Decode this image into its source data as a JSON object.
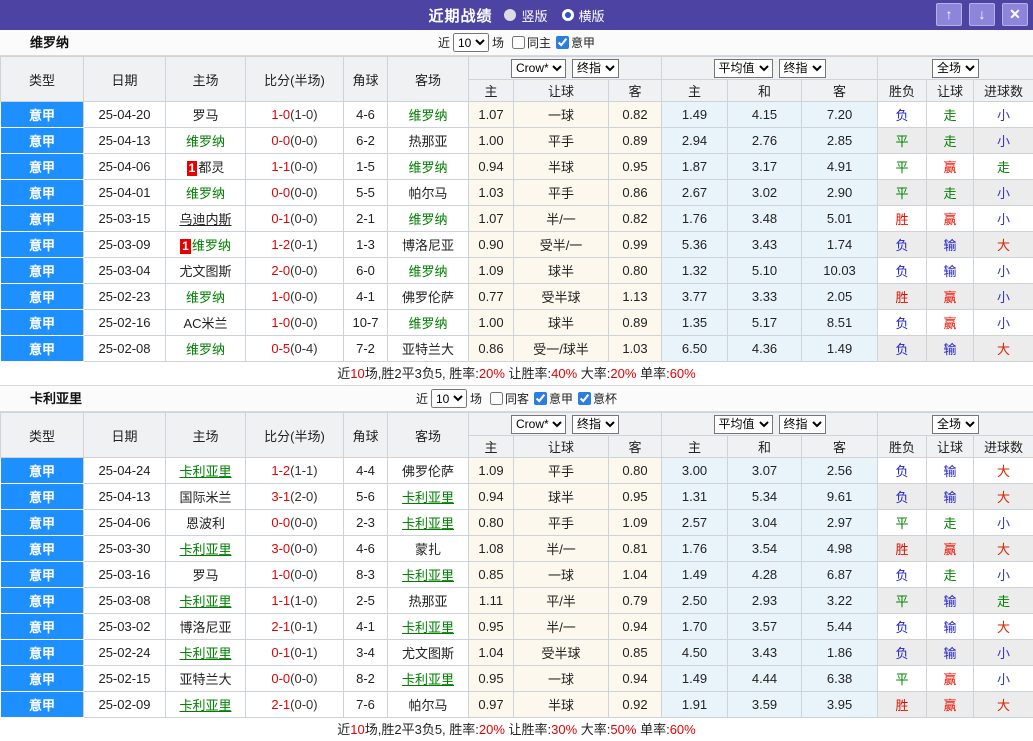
{
  "titlebar": {
    "title": "近期战绩",
    "radios": [
      {
        "label": "竖版",
        "selected": false
      },
      {
        "label": "横版",
        "selected": true
      }
    ],
    "buttons": {
      "up": "↑",
      "down": "↓",
      "close": "✕"
    }
  },
  "labels": {
    "near": "近",
    "matches": "场"
  },
  "columns": {
    "left": [
      "类型",
      "日期",
      "主场",
      "比分(半场)",
      "角球",
      "客场"
    ],
    "crow_select": "Crow*",
    "zhi_select": "终指",
    "avg_select": "平均值",
    "zhi2_select": "终指",
    "full_select": "全场",
    "crow_sub": [
      "主",
      "让球",
      "客"
    ],
    "avg_sub": [
      "主",
      "和",
      "客"
    ],
    "result_sub": [
      "胜负",
      "让球",
      "进球数"
    ]
  },
  "result_colors": {
    "胜": "#dd1100",
    "平": "#008000",
    "负": "#2222cc",
    "赢": "#ee1100",
    "走": "#008000",
    "输": "#2222cc",
    "大": "#dd2200",
    "小": "#3333cc"
  },
  "tables": [
    {
      "team": "维罗纳",
      "near_value": "10",
      "checkboxes": [
        {
          "label": "同主",
          "checked": false
        },
        {
          "label": "意甲",
          "checked": true
        }
      ],
      "rows": [
        {
          "league": "意甲",
          "date": "25-04-20",
          "home": {
            "name": "罗马"
          },
          "score": "1-0",
          "half": "(1-0)",
          "corner": "4-6",
          "away": {
            "name": "维罗纳",
            "focus": true
          },
          "crow": [
            "1.07",
            "一球",
            "0.82"
          ],
          "avg": [
            "1.49",
            "4.15",
            "7.20"
          ],
          "result": [
            "负",
            "走",
            "小"
          ]
        },
        {
          "league": "意甲",
          "date": "25-04-13",
          "home": {
            "name": "维罗纳",
            "focus": true
          },
          "score": "0-0",
          "half": "(0-0)",
          "corner": "6-2",
          "away": {
            "name": "热那亚"
          },
          "crow": [
            "1.00",
            "平手",
            "0.89"
          ],
          "avg": [
            "2.94",
            "2.76",
            "2.85"
          ],
          "result": [
            "平",
            "走",
            "小"
          ]
        },
        {
          "league": "意甲",
          "date": "25-04-06",
          "home": {
            "name": "都灵",
            "badge": true
          },
          "score": "1-1",
          "half": "(0-0)",
          "corner": "1-5",
          "away": {
            "name": "维罗纳",
            "focus": true
          },
          "crow": [
            "0.94",
            "半球",
            "0.95"
          ],
          "avg": [
            "1.87",
            "3.17",
            "4.91"
          ],
          "result": [
            "平",
            "赢",
            "走"
          ]
        },
        {
          "league": "意甲",
          "date": "25-04-01",
          "home": {
            "name": "维罗纳",
            "focus": true
          },
          "score": "0-0",
          "half": "(0-0)",
          "corner": "5-5",
          "away": {
            "name": "帕尔马"
          },
          "crow": [
            "1.03",
            "平手",
            "0.86"
          ],
          "avg": [
            "2.67",
            "3.02",
            "2.90"
          ],
          "result": [
            "平",
            "走",
            "小"
          ]
        },
        {
          "league": "意甲",
          "date": "25-03-15",
          "home": {
            "name": "乌迪内斯",
            "underline": true
          },
          "score": "0-1",
          "half": "(0-0)",
          "corner": "2-1",
          "away": {
            "name": "维罗纳",
            "focus": true
          },
          "crow": [
            "1.07",
            "半/一",
            "0.82"
          ],
          "avg": [
            "1.76",
            "3.48",
            "5.01"
          ],
          "result": [
            "胜",
            "赢",
            "小"
          ]
        },
        {
          "league": "意甲",
          "date": "25-03-09",
          "home": {
            "name": "维罗纳",
            "focus": true,
            "badge": true
          },
          "score": "1-2",
          "half": "(0-1)",
          "corner": "1-3",
          "away": {
            "name": "博洛尼亚"
          },
          "crow": [
            "0.90",
            "受半/一",
            "0.99"
          ],
          "avg": [
            "5.36",
            "3.43",
            "1.74"
          ],
          "result": [
            "负",
            "输",
            "大"
          ]
        },
        {
          "league": "意甲",
          "date": "25-03-04",
          "home": {
            "name": "尤文图斯"
          },
          "score": "2-0",
          "half": "(0-0)",
          "corner": "6-0",
          "away": {
            "name": "维罗纳",
            "focus": true
          },
          "crow": [
            "1.09",
            "球半",
            "0.80"
          ],
          "avg": [
            "1.32",
            "5.10",
            "10.03"
          ],
          "result": [
            "负",
            "输",
            "小"
          ]
        },
        {
          "league": "意甲",
          "date": "25-02-23",
          "home": {
            "name": "维罗纳",
            "focus": true
          },
          "score": "1-0",
          "half": "(0-0)",
          "corner": "4-1",
          "away": {
            "name": "佛罗伦萨"
          },
          "crow": [
            "0.77",
            "受半球",
            "1.13"
          ],
          "avg": [
            "3.77",
            "3.33",
            "2.05"
          ],
          "result": [
            "胜",
            "赢",
            "小"
          ]
        },
        {
          "league": "意甲",
          "date": "25-02-16",
          "home": {
            "name": "AC米兰"
          },
          "score": "1-0",
          "half": "(0-0)",
          "corner": "10-7",
          "away": {
            "name": "维罗纳",
            "focus": true
          },
          "crow": [
            "1.00",
            "球半",
            "0.89"
          ],
          "avg": [
            "1.35",
            "5.17",
            "8.51"
          ],
          "result": [
            "负",
            "赢",
            "小"
          ]
        },
        {
          "league": "意甲",
          "date": "25-02-08",
          "home": {
            "name": "维罗纳",
            "focus": true
          },
          "score": "0-5",
          "half": "(0-4)",
          "corner": "7-2",
          "away": {
            "name": "亚特兰大"
          },
          "crow": [
            "0.86",
            "受一/球半",
            "1.03"
          ],
          "avg": [
            "6.50",
            "4.36",
            "1.49"
          ],
          "result": [
            "负",
            "输",
            "大"
          ]
        }
      ],
      "summary": [
        [
          "近",
          "k"
        ],
        [
          "10",
          "r"
        ],
        [
          "场,胜2平3负5, 胜率:",
          "k"
        ],
        [
          "20%",
          "r"
        ],
        [
          " 让胜率:",
          "k"
        ],
        [
          "40%",
          "r"
        ],
        [
          " 大率:",
          "k"
        ],
        [
          "20%",
          "r"
        ],
        [
          " 单率:",
          "k"
        ],
        [
          "60%",
          "r"
        ]
      ]
    },
    {
      "team": "卡利亚里",
      "near_value": "10",
      "checkboxes": [
        {
          "label": "同客",
          "checked": false
        },
        {
          "label": "意甲",
          "checked": true
        },
        {
          "label": "意杯",
          "checked": true
        }
      ],
      "rows": [
        {
          "league": "意甲",
          "date": "25-04-24",
          "home": {
            "name": "卡利亚里",
            "focus": true,
            "underline": true
          },
          "score": "1-2",
          "half": "(1-1)",
          "corner": "4-4",
          "away": {
            "name": "佛罗伦萨"
          },
          "crow": [
            "1.09",
            "平手",
            "0.80"
          ],
          "avg": [
            "3.00",
            "3.07",
            "2.56"
          ],
          "result": [
            "负",
            "输",
            "大"
          ]
        },
        {
          "league": "意甲",
          "date": "25-04-13",
          "home": {
            "name": "国际米兰"
          },
          "score": "3-1",
          "half": "(2-0)",
          "corner": "5-6",
          "away": {
            "name": "卡利亚里",
            "focus": true,
            "underline": true
          },
          "crow": [
            "0.94",
            "球半",
            "0.95"
          ],
          "avg": [
            "1.31",
            "5.34",
            "9.61"
          ],
          "result": [
            "负",
            "输",
            "大"
          ]
        },
        {
          "league": "意甲",
          "date": "25-04-06",
          "home": {
            "name": "恩波利"
          },
          "score": "0-0",
          "half": "(0-0)",
          "corner": "2-3",
          "away": {
            "name": "卡利亚里",
            "focus": true,
            "underline": true
          },
          "crow": [
            "0.80",
            "平手",
            "1.09"
          ],
          "avg": [
            "2.57",
            "3.04",
            "2.97"
          ],
          "result": [
            "平",
            "走",
            "小"
          ]
        },
        {
          "league": "意甲",
          "date": "25-03-30",
          "home": {
            "name": "卡利亚里",
            "focus": true,
            "underline": true
          },
          "score": "3-0",
          "half": "(0-0)",
          "corner": "4-6",
          "away": {
            "name": "蒙扎"
          },
          "crow": [
            "1.08",
            "半/一",
            "0.81"
          ],
          "avg": [
            "1.76",
            "3.54",
            "4.98"
          ],
          "result": [
            "胜",
            "赢",
            "大"
          ]
        },
        {
          "league": "意甲",
          "date": "25-03-16",
          "home": {
            "name": "罗马"
          },
          "score": "1-0",
          "half": "(0-0)",
          "corner": "8-3",
          "away": {
            "name": "卡利亚里",
            "focus": true,
            "underline": true
          },
          "crow": [
            "0.85",
            "一球",
            "1.04"
          ],
          "avg": [
            "1.49",
            "4.28",
            "6.87"
          ],
          "result": [
            "负",
            "走",
            "小"
          ]
        },
        {
          "league": "意甲",
          "date": "25-03-08",
          "home": {
            "name": "卡利亚里",
            "focus": true,
            "underline": true
          },
          "score": "1-1",
          "half": "(1-0)",
          "corner": "2-5",
          "away": {
            "name": "热那亚"
          },
          "crow": [
            "1.11",
            "平/半",
            "0.79"
          ],
          "avg": [
            "2.50",
            "2.93",
            "3.22"
          ],
          "result": [
            "平",
            "输",
            "走"
          ]
        },
        {
          "league": "意甲",
          "date": "25-03-02",
          "home": {
            "name": "博洛尼亚"
          },
          "score": "2-1",
          "half": "(0-1)",
          "corner": "4-1",
          "away": {
            "name": "卡利亚里",
            "focus": true,
            "underline": true
          },
          "crow": [
            "0.95",
            "半/一",
            "0.94"
          ],
          "avg": [
            "1.70",
            "3.57",
            "5.44"
          ],
          "result": [
            "负",
            "输",
            "大"
          ]
        },
        {
          "league": "意甲",
          "date": "25-02-24",
          "home": {
            "name": "卡利亚里",
            "focus": true,
            "underline": true
          },
          "score": "0-1",
          "half": "(0-1)",
          "corner": "3-4",
          "away": {
            "name": "尤文图斯"
          },
          "crow": [
            "1.04",
            "受半球",
            "0.85"
          ],
          "avg": [
            "4.50",
            "3.43",
            "1.86"
          ],
          "result": [
            "负",
            "输",
            "小"
          ]
        },
        {
          "league": "意甲",
          "date": "25-02-15",
          "home": {
            "name": "亚特兰大"
          },
          "score": "0-0",
          "half": "(0-0)",
          "corner": "8-2",
          "away": {
            "name": "卡利亚里",
            "focus": true,
            "underline": true
          },
          "crow": [
            "0.95",
            "一球",
            "0.94"
          ],
          "avg": [
            "1.49",
            "4.44",
            "6.38"
          ],
          "result": [
            "平",
            "赢",
            "小"
          ]
        },
        {
          "league": "意甲",
          "date": "25-02-09",
          "home": {
            "name": "卡利亚里",
            "focus": true,
            "underline": true
          },
          "score": "2-1",
          "half": "(0-0)",
          "corner": "7-6",
          "away": {
            "name": "帕尔马"
          },
          "crow": [
            "0.97",
            "半球",
            "0.92"
          ],
          "avg": [
            "1.91",
            "3.59",
            "3.95"
          ],
          "result": [
            "胜",
            "赢",
            "大"
          ]
        }
      ],
      "summary": [
        [
          "近",
          "k"
        ],
        [
          "10",
          "r"
        ],
        [
          "场,胜2平3负5, 胜率:",
          "k"
        ],
        [
          "20%",
          "r"
        ],
        [
          " 让胜率:",
          "k"
        ],
        [
          "30%",
          "r"
        ],
        [
          " 大率:",
          "k"
        ],
        [
          "50%",
          "r"
        ],
        [
          " 单率:",
          "k"
        ],
        [
          "60%",
          "r"
        ]
      ]
    }
  ]
}
